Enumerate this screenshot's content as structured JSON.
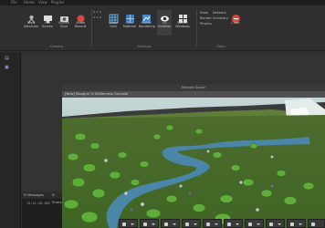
{
  "menu": [
    "File",
    "Home",
    "View",
    "Plugins"
  ],
  "ribbon": {
    "groups": [
      {
        "title": "Camera"
      },
      {
        "title": "Settings"
      },
      {
        "title": "Stats"
      }
    ],
    "buttons": [
      {
        "label": "View Selection"
      },
      {
        "label": "Full Screen"
      },
      {
        "label": "Screen Shot"
      },
      {
        "label": "Video Record"
      },
      {
        "label": "Show Grid"
      },
      {
        "label": "Grid Material"
      },
      {
        "label": "Studio Rendering"
      },
      {
        "label": "UI Visibility"
      },
      {
        "label": "Switch Windows"
      }
    ],
    "stats": [
      "Stats",
      "Network",
      "Render",
      "Summary",
      "Physics"
    ],
    "clear_label": "Clear"
  },
  "panel_title": "Remote Scene",
  "viewport_title": "[New] Roughin' It Wilderness Survival",
  "output": {
    "tabs": [
      "Messages",
      "Errors"
    ],
    "log": "19:41:26.082"
  },
  "colors": {
    "ui_visibility_active": "#3a3a3a",
    "clear_icon": "#d9463b",
    "grass": "#5b7d33",
    "water": "#3f7da0"
  }
}
